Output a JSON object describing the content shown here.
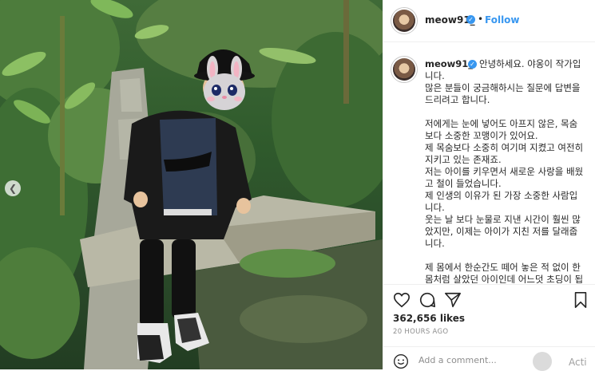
{
  "account": {
    "username": "meow91_",
    "verified": true
  },
  "header": {
    "follow_label": "Follow",
    "separator": "•"
  },
  "caption": {
    "username": "meow91_",
    "text": "안녕하세요. 야옹이 작가입니다.\n많은 분들이 궁금해하시는 질문에 답변을 드리려고 합니다.\n\n저에게는 눈에 넣어도 아프지 않은, 목숨보다 소중한 꼬맹이가 있어요.\n제 목숨보다 소중히 여기며 지켰고 여전히 지키고 있는 존재죠.\n저는 아이를 키우면서 새로운 사랑을 배웠고 철이 들었습니다.\n제 인생의 이유가 된 가장 소중한 사람입니다.\n웃는 날 보다 눈물로 지낸 시간이 훨씬 많았지만, 이제는 아이가 지친 저를 달래줍니다.\n\n제 몸에서 한순간도 떼어 놓은 적 없이 한 몸처럼 살았던 아이인데 어느덧 초딩이 됩니다 ㅎㅎ"
  },
  "actions": {
    "icons": [
      "heart-icon",
      "comment-icon",
      "share-icon",
      "bookmark-icon"
    ]
  },
  "stats": {
    "likes": "362,656 likes",
    "time_ago": "20 HOURS AGO"
  },
  "comment": {
    "placeholder": "Add a comment...",
    "overlay_text": "Acti"
  },
  "colors": {
    "accent": "#3897f0",
    "text": "#262626",
    "muted": "#8e8e8e",
    "border": "#efefef"
  }
}
